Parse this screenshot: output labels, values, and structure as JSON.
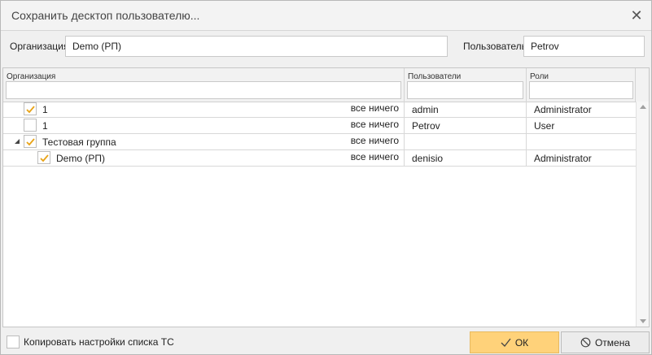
{
  "dialog": {
    "title": "Сохранить десктоп пользователю..."
  },
  "filters": {
    "org_label": "Организация",
    "org_value": "Demo (РП)",
    "user_label": "Пользователь",
    "user_value": "Petrov"
  },
  "grid": {
    "columns": {
      "org": "Организация",
      "users": "Пользователи",
      "roles": "Роли"
    },
    "rows": [
      {
        "name": "1",
        "checked": true,
        "all": "все",
        "none": "ничего",
        "user": "admin",
        "role": "Administrator"
      },
      {
        "name": "1",
        "checked": false,
        "all": "все",
        "none": "ничего",
        "user": "Petrov",
        "role": "User"
      },
      {
        "name": "Тестовая группа",
        "checked": true,
        "expanded": true,
        "all": "все",
        "none": "ничего",
        "user": "",
        "role": ""
      },
      {
        "name": "Demo (РП)",
        "checked": true,
        "all": "все",
        "none": "ничего",
        "user": "denisio",
        "role": "Administrator"
      }
    ]
  },
  "footer": {
    "copy_label": "Копировать настройки списка ТС",
    "copy_checked": false,
    "ok_label": "ОК",
    "cancel_label": "Отмена"
  },
  "icons": {
    "close": "close-icon",
    "check": "check-icon",
    "expand": "collapse-triangle-icon",
    "cancel": "no-entry-icon"
  },
  "colors": {
    "accent": "#ffd27a",
    "check": "#e8a317"
  }
}
